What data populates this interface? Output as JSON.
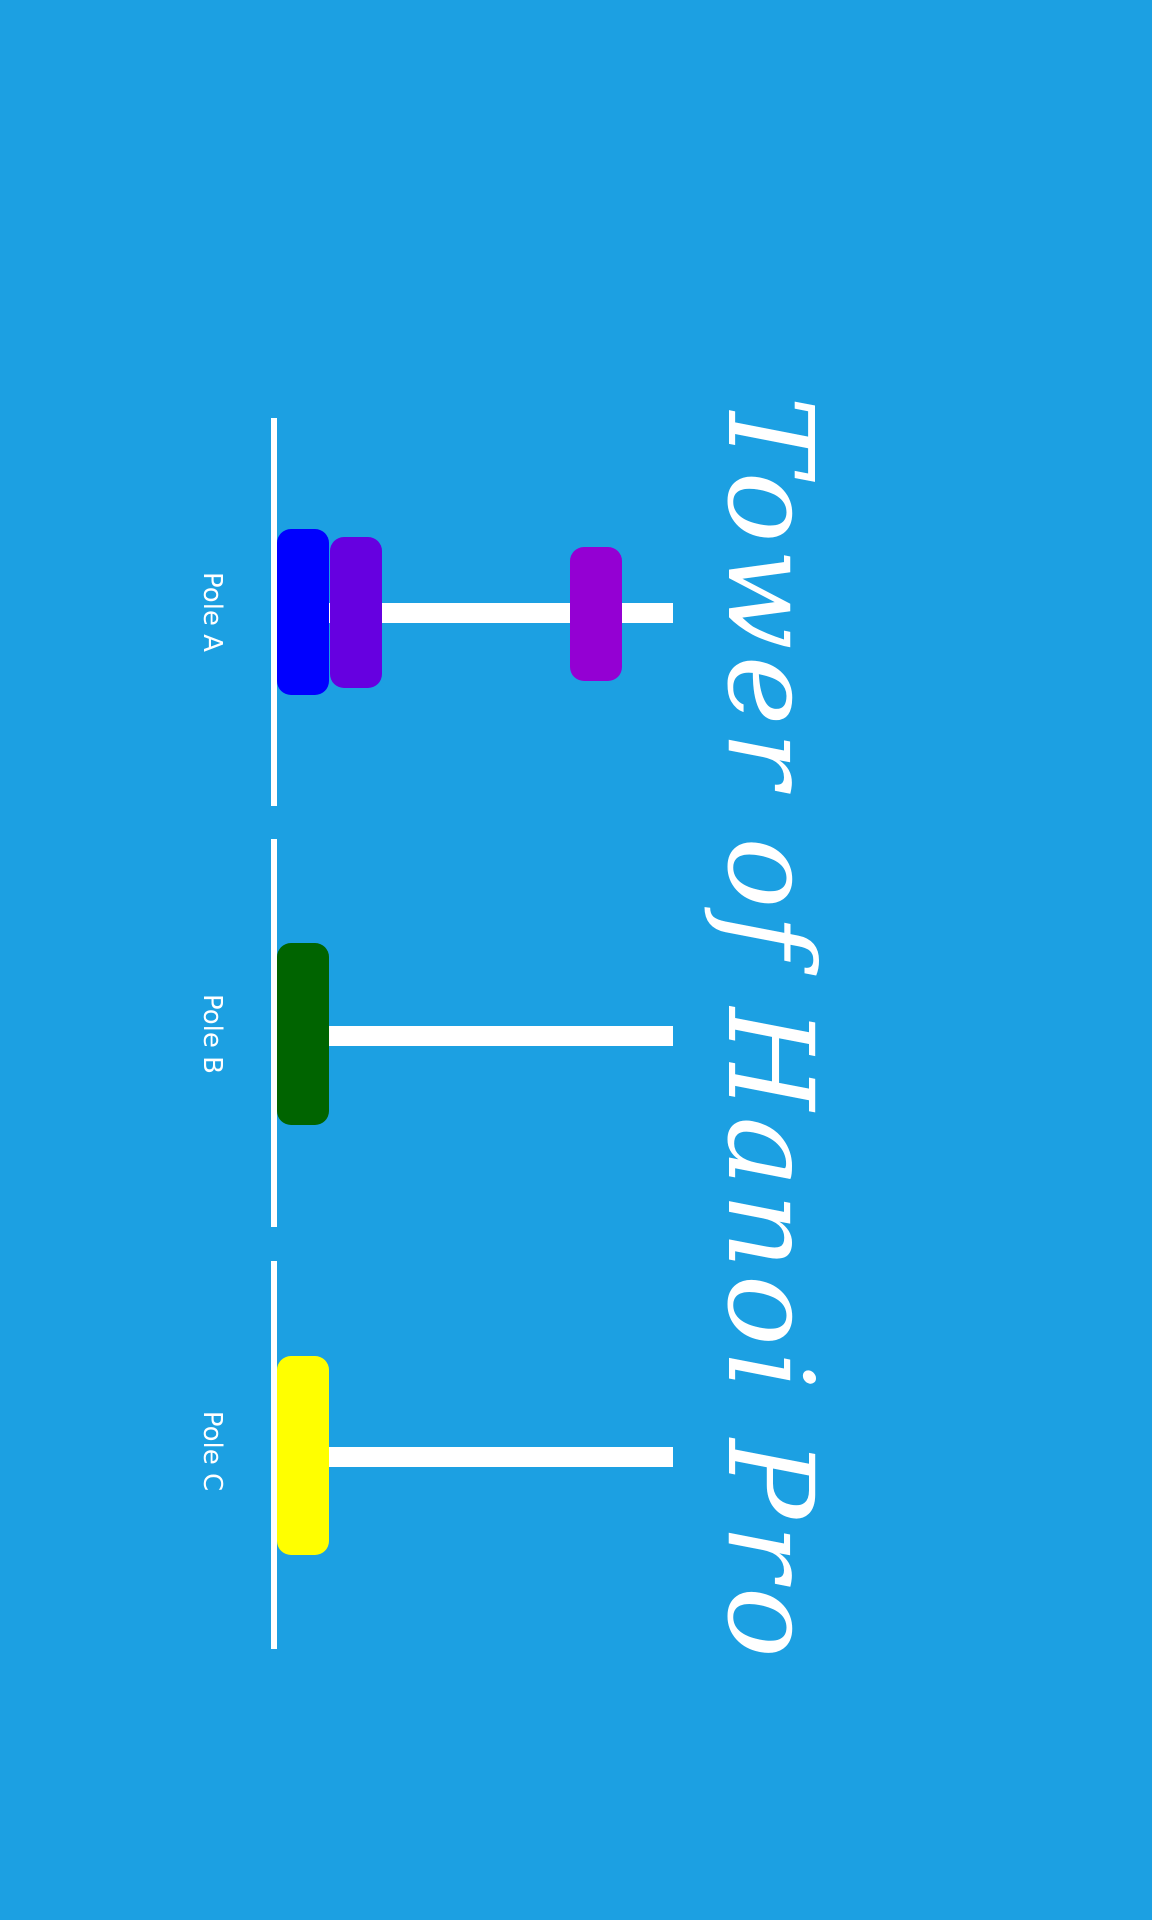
{
  "title": "Tower of Hanoi Pro",
  "colors": {
    "background": "#1ca0e2",
    "pole": "#ffffff"
  },
  "poles": [
    {
      "label": "Pole A",
      "disks": [
        {
          "color": "#0000ff"
        },
        {
          "color": "#6600e0"
        },
        {
          "color": "#9400d3"
        }
      ]
    },
    {
      "label": "Pole B",
      "disks": [
        {
          "color": "#006400"
        }
      ]
    },
    {
      "label": "Pole C",
      "disks": [
        {
          "color": "#ffff00"
        }
      ]
    }
  ]
}
